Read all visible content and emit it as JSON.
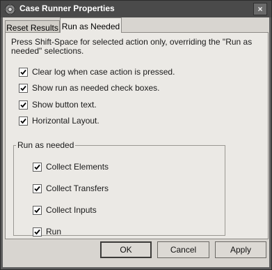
{
  "window": {
    "title": "Case Runner Properties",
    "close_label": "×"
  },
  "tabs": [
    {
      "label": "Reset Results",
      "active": false
    },
    {
      "label": "Run as Needed",
      "active": true
    }
  ],
  "panel": {
    "note": "Press Shift-Space for selected action only, overriding the \"Run as needed\" selections.",
    "options": [
      {
        "label": "Clear log when case action is pressed.",
        "checked": true
      },
      {
        "label": "Show run as needed check boxes.",
        "checked": true
      },
      {
        "label": "Show button text.",
        "checked": true
      },
      {
        "label": "Horizontal Layout.",
        "checked": true
      }
    ],
    "group": {
      "legend": "Run as needed",
      "items": [
        {
          "label": "Collect Elements",
          "checked": true
        },
        {
          "label": "Collect Transfers",
          "checked": true
        },
        {
          "label": "Collect Inputs",
          "checked": true
        },
        {
          "label": "Run",
          "checked": true
        }
      ]
    }
  },
  "buttons": {
    "ok": "OK",
    "cancel": "Cancel",
    "apply": "Apply"
  },
  "icons": {
    "app": "gear-app-icon",
    "check": "checkmark-icon"
  }
}
